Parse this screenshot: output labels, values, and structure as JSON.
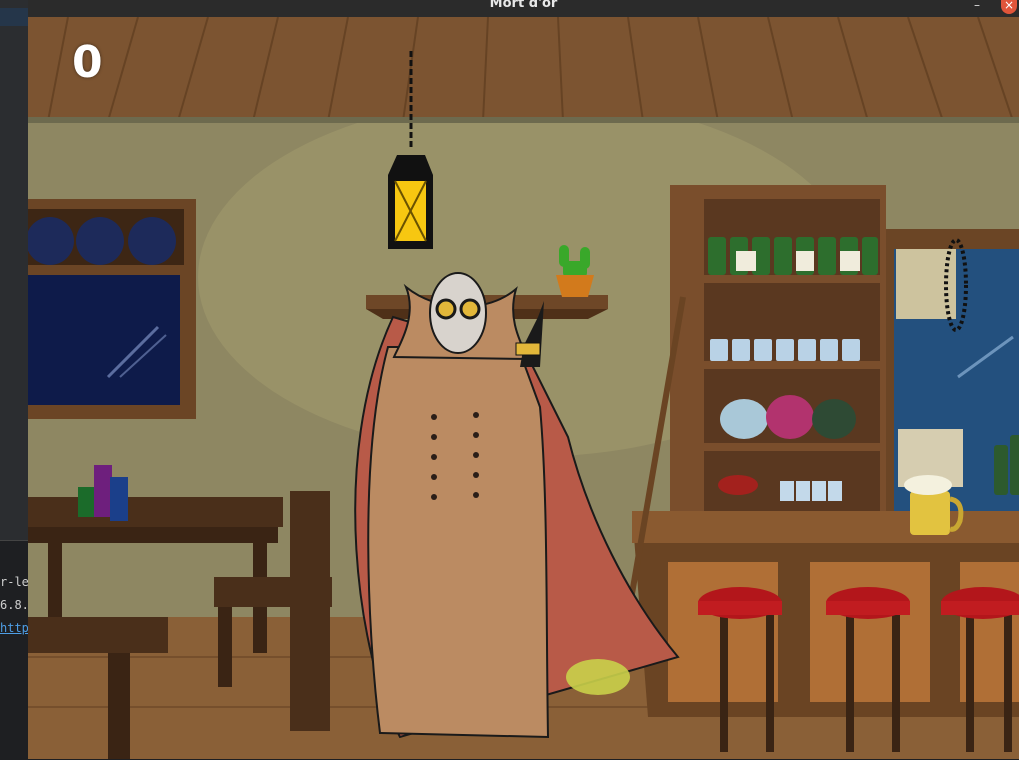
{
  "window": {
    "title": "Mort d'or",
    "minimize_glyph": "–",
    "close_glyph": "×"
  },
  "editor": {
    "console_lines": [
      "r-le/",
      "6.8.",
      "http"
    ]
  },
  "game": {
    "score": "0"
  },
  "colors": {
    "titlebar": "#2b2b2b",
    "close_button": "#e0553a",
    "score_text": "#ffffff",
    "wall": "#8e8762",
    "ceiling": "#7c5431",
    "floor": "#8a6037"
  },
  "icons": [
    "lantern",
    "cactus-pot",
    "bottles",
    "mugs",
    "potion-flasks",
    "beer-mug",
    "bar-stools",
    "candles",
    "hooded-character",
    "sword-hilt"
  ]
}
